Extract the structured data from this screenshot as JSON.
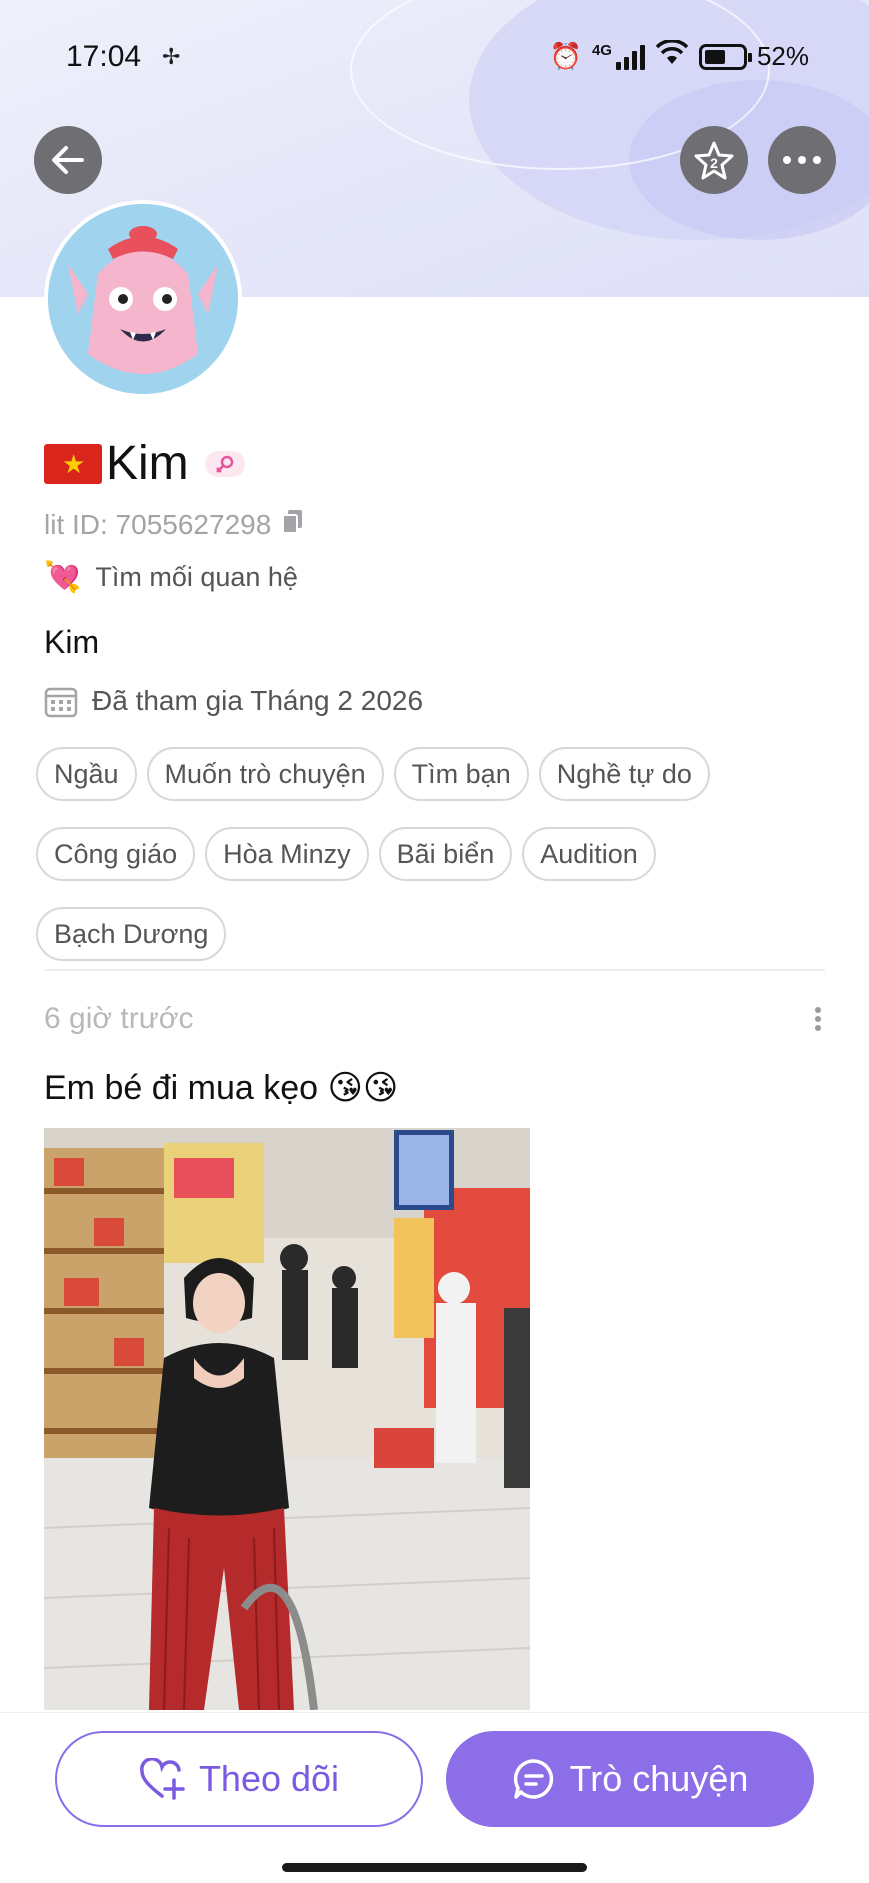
{
  "status_bar": {
    "time": "17:04",
    "network": "4G",
    "battery": "52%"
  },
  "header": {
    "back_icon": "arrow-left-icon",
    "star_icon": "star-icon",
    "more_icon": "more-horizontal-icon"
  },
  "profile": {
    "flag": "vietnam-flag",
    "name": "Kim",
    "gender_icon": "female-icon",
    "lit_id": "lit ID: 7055627298",
    "seek_icon": "heart-arrow-icon",
    "seeking": "Tìm mối quan hệ",
    "display_name": "Kim",
    "joined": "Đã tham gia Tháng 2 2026"
  },
  "tags": [
    "Ngầu",
    "Muốn trò chuyện",
    "Tìm bạn",
    "Nghề tự do",
    "Công giáo",
    "Hòa Minzy",
    "Bãi biển",
    "Audition",
    "Bạch Dương"
  ],
  "post": {
    "time": "6 giờ trước",
    "text": "Em bé đi mua kẹo 😘😘"
  },
  "actions": {
    "follow_label": "Theo dõi",
    "chat_label": "Trò chuyện"
  },
  "colors": {
    "accent": "#8b6ee8",
    "header_bg": "#e6e8f9"
  }
}
